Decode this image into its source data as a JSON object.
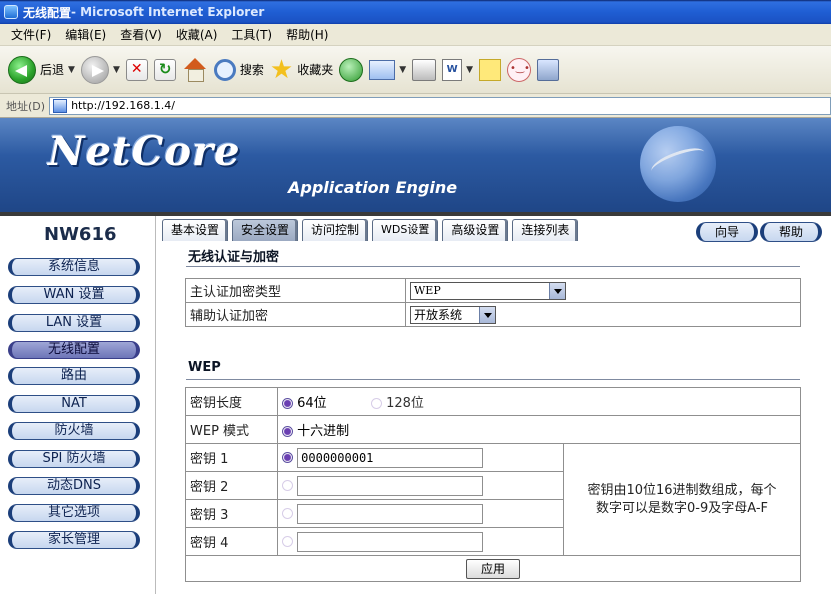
{
  "window": {
    "title_part1": "无线配置",
    "title_part2": " - Microsoft Internet Explorer"
  },
  "menu": [
    "文件(F)",
    "编辑(E)",
    "查看(V)",
    "收藏(A)",
    "工具(T)",
    "帮助(H)"
  ],
  "toolbar": {
    "back_label": "后退",
    "search_label": "搜索",
    "favorites_label": "收藏夹",
    "word_label": "W"
  },
  "address": {
    "label": "地址(D)",
    "url": "http://192.168.1.4/"
  },
  "banner": {
    "logo": "NetCore",
    "subtitle": "Application Engine"
  },
  "sidebar": {
    "model": "NW616",
    "items": [
      {
        "label": "系统信息"
      },
      {
        "label": "WAN 设置"
      },
      {
        "label": "LAN 设置"
      },
      {
        "label": "无线配置"
      },
      {
        "label": "路由"
      },
      {
        "label": "NAT"
      },
      {
        "label": "防火墙"
      },
      {
        "label": "SPI 防火墙"
      },
      {
        "label": "动态DNS"
      },
      {
        "label": "其它选项"
      },
      {
        "label": "家长管理"
      }
    ],
    "active_index": 3
  },
  "tabs": [
    {
      "label": "基本设置"
    },
    {
      "label": "安全设置"
    },
    {
      "label": "访问控制"
    },
    {
      "label": "WDS设置"
    },
    {
      "label": "高级设置"
    },
    {
      "label": "连接列表"
    }
  ],
  "active_tab": 1,
  "buttons": {
    "wizard": "向导",
    "help": "帮助",
    "apply": "应用"
  },
  "auth": {
    "section_title": "无线认证与加密",
    "primary_label": "主认证加密类型",
    "primary_value": "WEP",
    "secondary_label": "辅助认证加密",
    "secondary_value": "开放系统"
  },
  "wep": {
    "section_title": "WEP",
    "key_length_label": "密钥长度",
    "key_length_64": "64位",
    "key_length_128": "128位",
    "mode_label": "WEP 模式",
    "mode_value": "十六进制",
    "keys": [
      {
        "label": "密钥 1",
        "value": "0000000001",
        "selected": true
      },
      {
        "label": "密钥 2",
        "value": "",
        "selected": false
      },
      {
        "label": "密钥 3",
        "value": "",
        "selected": false
      },
      {
        "label": "密钥 4",
        "value": "",
        "selected": false
      }
    ],
    "hint_line1": "密钥由10位16进制数组成，每个",
    "hint_line2": "数字可以是数字0-9及字母A-F"
  }
}
